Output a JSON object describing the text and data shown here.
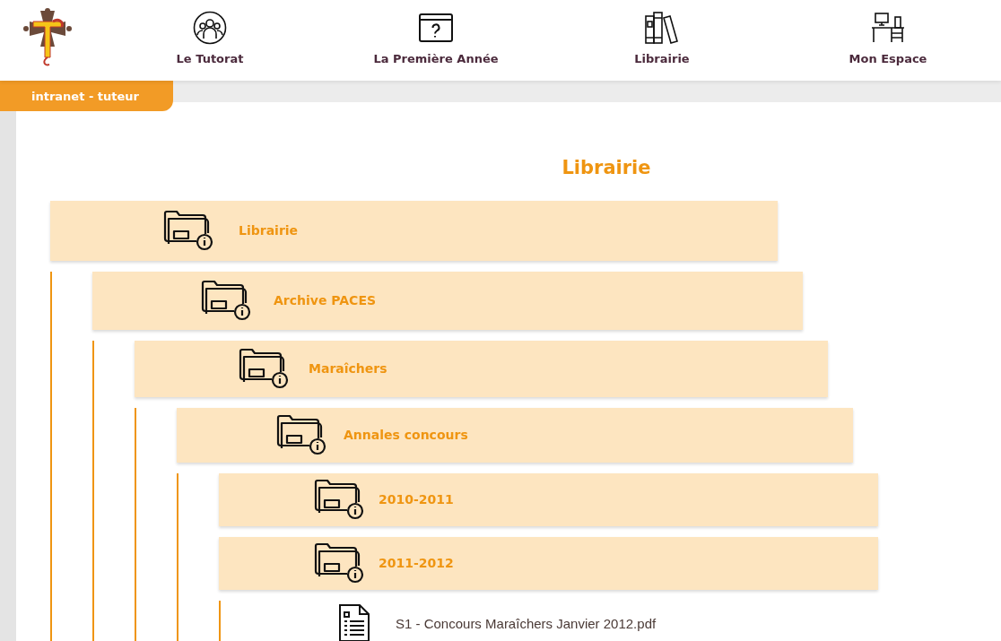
{
  "nav": [
    {
      "label": "Le Tutorat"
    },
    {
      "label": "La Première Année"
    },
    {
      "label": "Librairie"
    },
    {
      "label": "Mon Espace"
    }
  ],
  "badge": "intranet - tuteur",
  "title": "Librairie",
  "tree": [
    {
      "kind": "folder",
      "label": "Librairie",
      "children": [
        {
          "kind": "folder",
          "label": "Archive PACES",
          "children": [
            {
              "kind": "folder",
              "label": "Maraîchers",
              "children": [
                {
                  "kind": "folder",
                  "label": "Annales concours",
                  "children": [
                    {
                      "kind": "folder",
                      "label": "2010-2011"
                    },
                    {
                      "kind": "folder",
                      "label": "2011-2012",
                      "children": [
                        {
                          "kind": "file",
                          "label": "S1 - Concours Maraîchers Janvier 2012.pdf"
                        }
                      ]
                    }
                  ]
                }
              ]
            }
          ]
        }
      ]
    }
  ]
}
